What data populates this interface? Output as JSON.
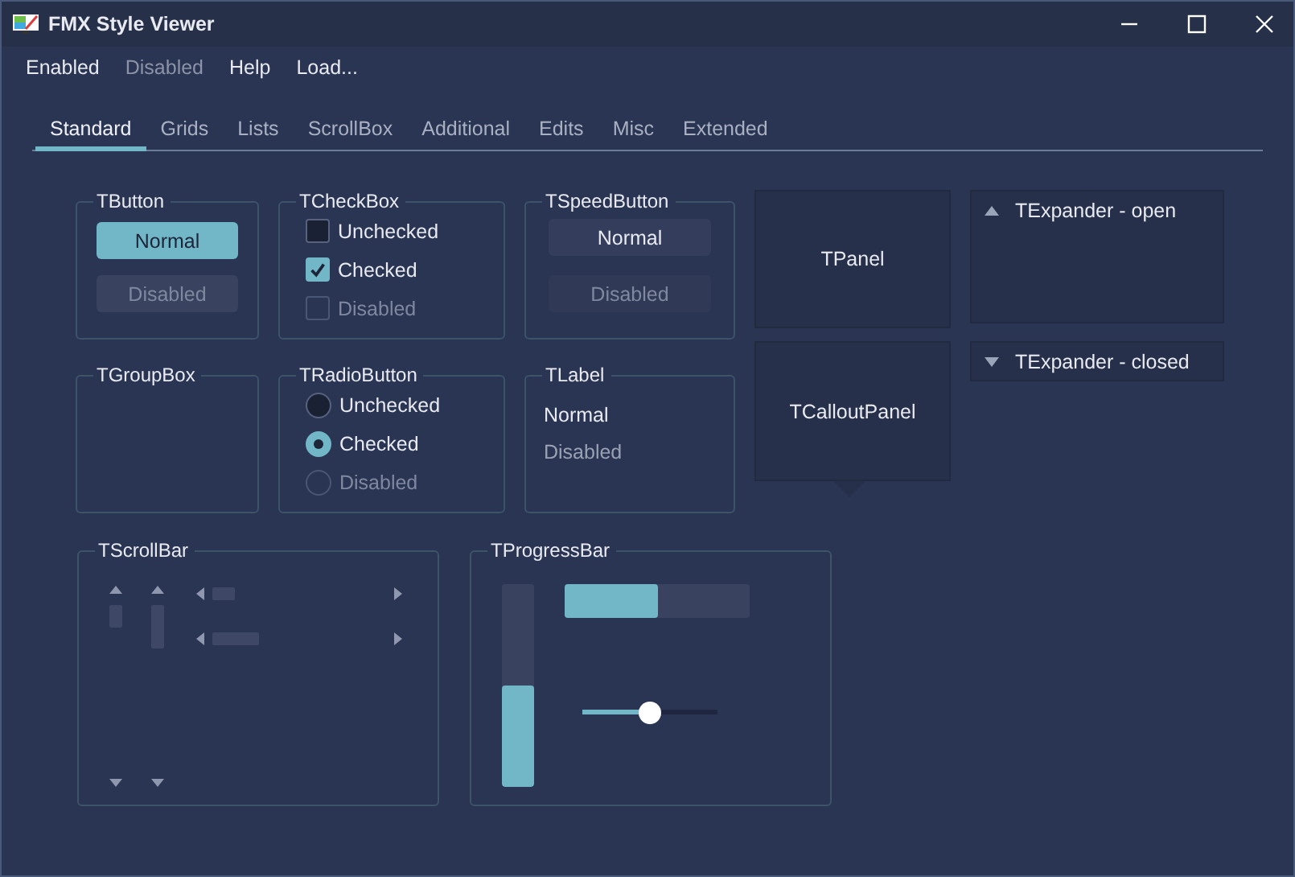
{
  "window": {
    "title": "FMX Style Viewer"
  },
  "menu": [
    {
      "label": "Enabled",
      "disabled": false
    },
    {
      "label": "Disabled",
      "disabled": true
    },
    {
      "label": "Help",
      "disabled": false
    },
    {
      "label": "Load...",
      "disabled": false
    }
  ],
  "tabs": [
    {
      "label": "Standard",
      "selected": true
    },
    {
      "label": "Grids",
      "selected": false
    },
    {
      "label": "Lists",
      "selected": false
    },
    {
      "label": "ScrollBox",
      "selected": false
    },
    {
      "label": "Additional",
      "selected": false
    },
    {
      "label": "Edits",
      "selected": false
    },
    {
      "label": "Misc",
      "selected": false
    },
    {
      "label": "Extended",
      "selected": false
    }
  ],
  "button_box": {
    "title": "TButton",
    "buttons": [
      {
        "label": "Normal",
        "disabled": false
      },
      {
        "label": "Disabled",
        "disabled": true
      }
    ]
  },
  "checkbox_box": {
    "title": "TCheckBox",
    "items": [
      {
        "label": "Unchecked",
        "checked": false,
        "disabled": false
      },
      {
        "label": "Checked",
        "checked": true,
        "disabled": false
      },
      {
        "label": "Disabled",
        "checked": false,
        "disabled": true
      }
    ]
  },
  "speedbutton_box": {
    "title": "TSpeedButton",
    "buttons": [
      {
        "label": "Normal",
        "disabled": false
      },
      {
        "label": "Disabled",
        "disabled": true
      }
    ]
  },
  "panel": {
    "text": "TPanel"
  },
  "expanders": [
    {
      "title": "TExpander - open",
      "expanded": true
    },
    {
      "title": "TExpander - closed",
      "expanded": false
    }
  ],
  "groupbox": {
    "title": "TGroupBox"
  },
  "radio_box": {
    "title": "TRadioButton",
    "items": [
      {
        "label": "Unchecked",
        "selected": false,
        "disabled": false
      },
      {
        "label": "Checked",
        "selected": true,
        "disabled": false
      },
      {
        "label": "Disabled",
        "selected": false,
        "disabled": true
      }
    ]
  },
  "label_box": {
    "title": "TLabel",
    "labels": [
      {
        "text": "Normal",
        "disabled": false
      },
      {
        "text": "Disabled",
        "disabled": true
      }
    ]
  },
  "callout_panel": {
    "text": "TCalloutPanel"
  },
  "scrollbar_box": {
    "title": "TScrollBar"
  },
  "progress_box": {
    "title": "TProgressBar",
    "vertical_progress": {
      "level": 0.5
    },
    "horizontal_progress": {
      "level": 0.5
    },
    "trackbar": {
      "level": 0.5
    }
  }
}
